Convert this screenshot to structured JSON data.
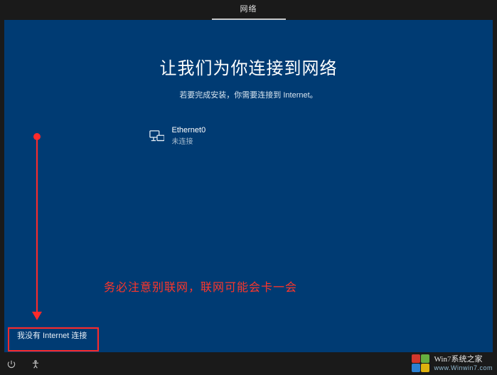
{
  "topbar": {
    "tab_label": "网络"
  },
  "main": {
    "heading": "让我们为你连接到网络",
    "subheading": "若要完成安装，你需要连接到 Internet。",
    "networks": [
      {
        "name": "Ethernet0",
        "status": "未连接"
      }
    ],
    "skip_label": "我没有 Internet 连接"
  },
  "annotation": {
    "note": "务必注意别联网，联网可能会卡一会"
  },
  "watermark": {
    "line1_a": "Win",
    "line1_b": "7",
    "line1_c": "系统之家",
    "line2": "www.Winwin7.com"
  }
}
